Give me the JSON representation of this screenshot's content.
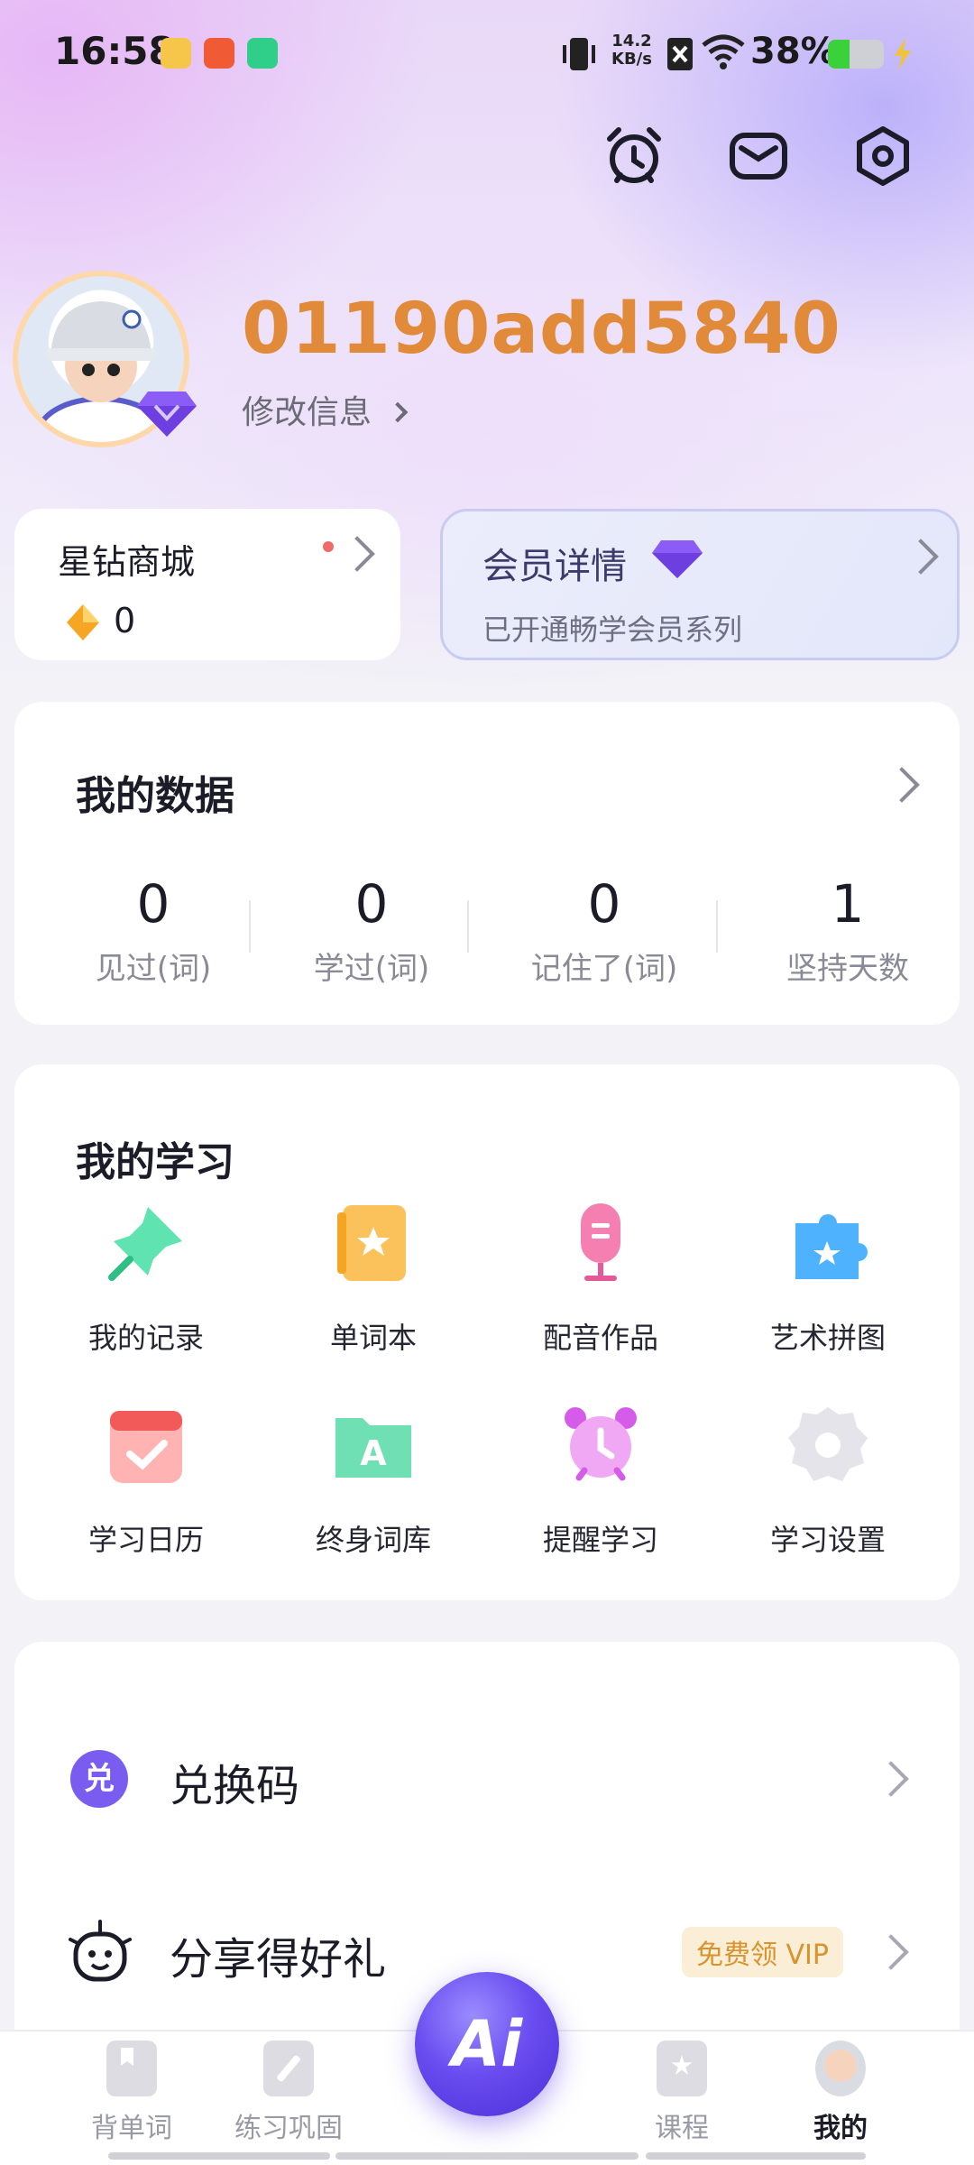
{
  "status_bar": {
    "time": "16:58",
    "net_speed_value": "14.2",
    "net_speed_unit": "KB/s",
    "battery_pct": "38%",
    "battery_level": 0.38
  },
  "profile": {
    "username": "01190add5840",
    "edit_label": "修改信息"
  },
  "shop": {
    "title": "星钻商城",
    "balance": "0"
  },
  "membership": {
    "title": "会员详情",
    "subtitle": "已开通畅学会员系列"
  },
  "my_data": {
    "title": "我的数据",
    "stats": [
      {
        "value": "0",
        "label": "见过(词)"
      },
      {
        "value": "0",
        "label": "学过(词)"
      },
      {
        "value": "0",
        "label": "记住了(词)"
      },
      {
        "value": "1",
        "label": "坚持天数"
      }
    ]
  },
  "my_study": {
    "title": "我的学习",
    "tools": [
      {
        "label": "我的记录",
        "icon": "pin-icon"
      },
      {
        "label": "单词本",
        "icon": "notebook-icon"
      },
      {
        "label": "配音作品",
        "icon": "microphone-icon"
      },
      {
        "label": "艺术拼图",
        "icon": "puzzle-icon"
      },
      {
        "label": "学习日历",
        "icon": "calendar-icon"
      },
      {
        "label": "终身词库",
        "icon": "folder-icon"
      },
      {
        "label": "提醒学习",
        "icon": "alarm-icon"
      },
      {
        "label": "学习设置",
        "icon": "gear-icon"
      }
    ]
  },
  "menu": {
    "items": [
      {
        "label": "兑换码",
        "icon": "redeem-icon",
        "icon_text": "兑"
      },
      {
        "label": "分享得好礼",
        "icon": "smiley-gift-icon",
        "tag": "免费领 VIP"
      }
    ]
  },
  "bottom_nav": {
    "items": [
      {
        "label": "背单词"
      },
      {
        "label": "练习巩固"
      },
      {
        "label": "课程"
      },
      {
        "label": "我的"
      }
    ],
    "ai_label": "Ai"
  },
  "colors": {
    "accent_orange": "#e08a3a",
    "accent_purple": "#6a4df0",
    "badge_red": "#f06a6a"
  }
}
